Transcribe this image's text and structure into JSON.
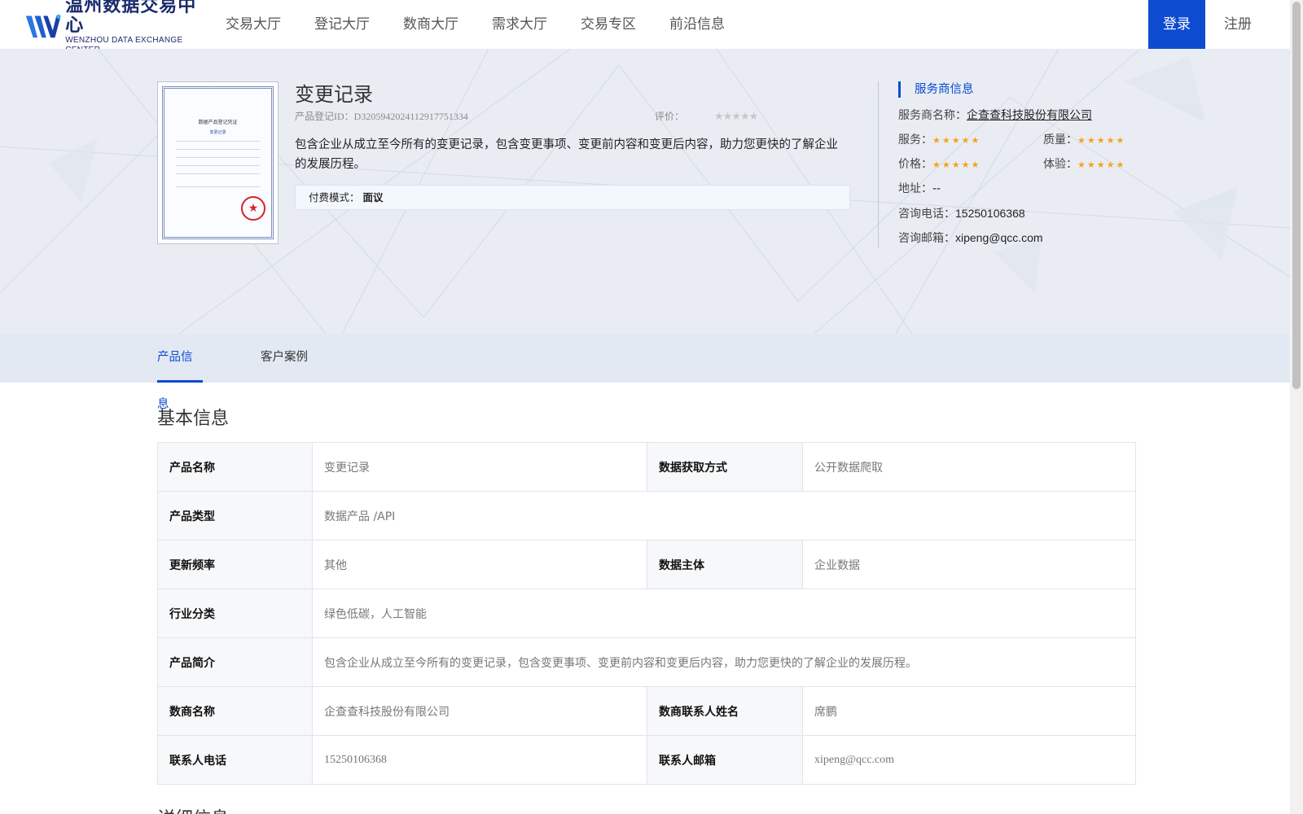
{
  "header": {
    "logo_cn": "温州数据交易中心",
    "logo_en": "WENZHOU DATA EXCHANGE CENTER",
    "nav": [
      "交易大厅",
      "登记大厅",
      "数商大厅",
      "需求大厅",
      "交易专区",
      "前沿信息"
    ],
    "login": "登录",
    "register": "注册"
  },
  "product": {
    "title": "变更记录",
    "id_label": "产品登记ID：",
    "id_value": "D32059420241129177513​34",
    "rating_label": "评价：",
    "rating_stars": "★★★★★",
    "rating_value": 0,
    "description": "包含企业从成立至今所有的变更记录，包含变更事项、变更前内容和变更后内容，助力您更快的了解企业的发展历程。",
    "pay_label": "付费模式：",
    "pay_value": "面议"
  },
  "certificate": {
    "title": "数据产品登记凭证",
    "subtitle": "变更记录"
  },
  "provider": {
    "heading": "服务商信息",
    "name_label": "服务商名称：",
    "name_value": "企查查科技股份有限公司",
    "service_label": "服务：",
    "quality_label": "质量：",
    "price_label": "价格：",
    "experience_label": "体验：",
    "stars": "★★★★★",
    "scores": {
      "service": 5,
      "quality": 5,
      "price": 5,
      "experience": 5
    },
    "address_label": "地址：",
    "address_value": "--",
    "phone_label": "咨询电话：",
    "phone_value": "15250106368",
    "email_label": "咨询邮箱：",
    "email_value": "xipeng@qcc.com",
    "accent_color": "#0d4bd1",
    "star_color": "#f7a21a"
  },
  "tabs": [
    "产品信息",
    "客户案例"
  ],
  "basic_info": {
    "title": "基本信息",
    "rows": [
      {
        "k1": "产品名称",
        "v1": "变更记录",
        "k2": "数据获取方式",
        "v2": "公开数据爬取"
      },
      {
        "k1": "产品类型",
        "v1": "数据产品 /API"
      },
      {
        "k1": "更新频率",
        "v1": "其他",
        "k2": "数据主体",
        "v2": "企业数据"
      },
      {
        "k1": "行业分类",
        "v1": "绿色低碳，人工智能"
      },
      {
        "k1": "产品简介",
        "v1": "包含企业从成立至今所有的变更记录，包含变更事项、变更前内容和变更后内容，助力您更快的了解企业的发展历程。"
      },
      {
        "k1": "数商名称",
        "v1": "企查查科技股份有限公司",
        "k2": "数商联系人姓名",
        "v2": "席鹏"
      },
      {
        "k1": "联系人电话",
        "v1": "15250106368",
        "k2": "联系人邮箱",
        "v2": "xipeng@qcc.com"
      }
    ]
  },
  "detail_info": {
    "title": "详细信息"
  }
}
